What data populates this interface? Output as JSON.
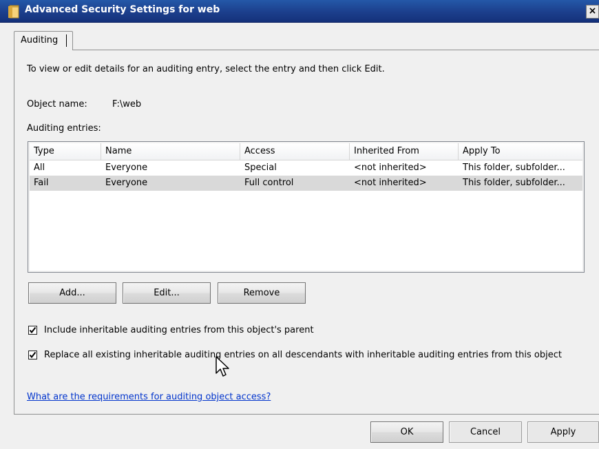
{
  "window": {
    "title": "Advanced Security Settings for web",
    "close_glyph": "×",
    "icon": "folder-icon"
  },
  "tabs": [
    {
      "label": "Auditing",
      "selected": true
    }
  ],
  "intro_text": "To view or edit details for an auditing entry, select the entry and then click Edit.",
  "object": {
    "label": "Object name:",
    "value": "F:\\web"
  },
  "entries_label": "Auditing entries:",
  "table": {
    "columns": [
      "Type",
      "Name",
      "Access",
      "Inherited From",
      "Apply To"
    ],
    "rows": [
      [
        "All",
        "Everyone",
        "Special",
        "<not inherited>",
        "This folder, subfolder..."
      ],
      [
        "Fail",
        "Everyone",
        "Full control",
        "<not inherited>",
        "This folder, subfolder..."
      ]
    ],
    "selected_row": 1
  },
  "buttons": {
    "add": "Add...",
    "edit": "Edit...",
    "remove": "Remove",
    "ok": "OK",
    "cancel": "Cancel",
    "apply": "Apply"
  },
  "checkboxes": {
    "include_inheritable": {
      "label": "Include inheritable auditing entries from this object's parent",
      "checked": true
    },
    "replace_all": {
      "label": "Replace all existing inheritable auditing entries on all descendants with inheritable auditing entries from this object",
      "checked": true
    }
  },
  "help_link": "What are the requirements for auditing object access?",
  "colors": {
    "titlebar": "#1c3f8c",
    "link": "#0033cc",
    "selected_row": "#d9d9d9"
  }
}
